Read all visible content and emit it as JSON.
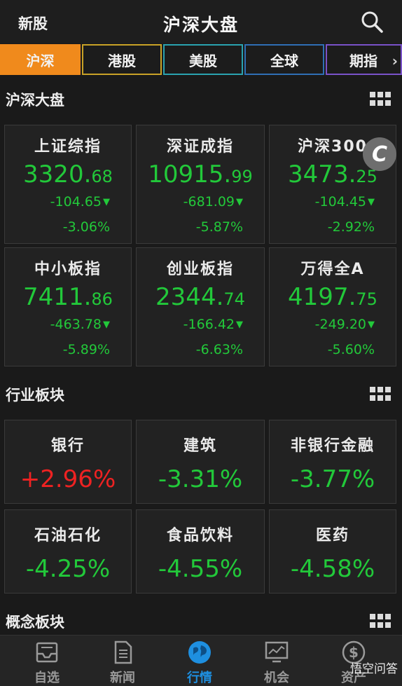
{
  "header": {
    "left": "新股",
    "title": "沪深大盘"
  },
  "tabs": [
    {
      "label": "沪深",
      "color": "#f08a1c",
      "active": true
    },
    {
      "label": "港股",
      "color": "#c9a227"
    },
    {
      "label": "美股",
      "color": "#2aa3b0"
    },
    {
      "label": "全球",
      "color": "#2f6fb5"
    },
    {
      "label": "期指",
      "color": "#7a52c9"
    }
  ],
  "sections": {
    "market": "沪深大盘",
    "industry": "行业板块",
    "concept": "概念板块"
  },
  "indices": [
    {
      "name": "上证综指",
      "price_main": "3320.",
      "price_dec": "68",
      "change": "-104.65",
      "pct": "-3.06%"
    },
    {
      "name": "深证成指",
      "price_main": "10915.",
      "price_dec": "99",
      "change": "-681.09",
      "pct": "-5.87%"
    },
    {
      "name": "沪深300",
      "price_main": "3473.",
      "price_dec": "25",
      "change": "-104.45",
      "pct": "-2.92%"
    },
    {
      "name": "中小板指",
      "price_main": "7411.",
      "price_dec": "86",
      "change": "-463.78",
      "pct": "-5.89%"
    },
    {
      "name": "创业板指",
      "price_main": "2344.",
      "price_dec": "74",
      "change": "-166.42",
      "pct": "-6.63%"
    },
    {
      "name": "万得全A",
      "price_main": "4197.",
      "price_dec": "75",
      "change": "-249.20",
      "pct": "-5.60%"
    }
  ],
  "industries": [
    {
      "name": "银行",
      "pct": "+2.96%",
      "direction": "up"
    },
    {
      "name": "建筑",
      "pct": "-3.31%",
      "direction": "down"
    },
    {
      "name": "非银行金融",
      "pct": "-3.77%",
      "direction": "down"
    },
    {
      "name": "石油石化",
      "pct": "-4.25%",
      "direction": "down"
    },
    {
      "name": "食品饮料",
      "pct": "-4.55%",
      "direction": "down"
    },
    {
      "name": "医药",
      "pct": "-4.58%",
      "direction": "down"
    }
  ],
  "float_badge": "C",
  "nav": [
    {
      "label": "自选",
      "icon": "inbox-icon"
    },
    {
      "label": "新闻",
      "icon": "document-icon"
    },
    {
      "label": "行情",
      "icon": "globe-icon",
      "active": true
    },
    {
      "label": "机会",
      "icon": "chart-icon"
    },
    {
      "label": "资产",
      "icon": "dollar-icon"
    }
  ],
  "watermark": "悟空问答",
  "colors": {
    "up": "#ee2222",
    "down": "#22c93a",
    "accent": "#f08a1c",
    "nav_active": "#1e8fe0"
  }
}
